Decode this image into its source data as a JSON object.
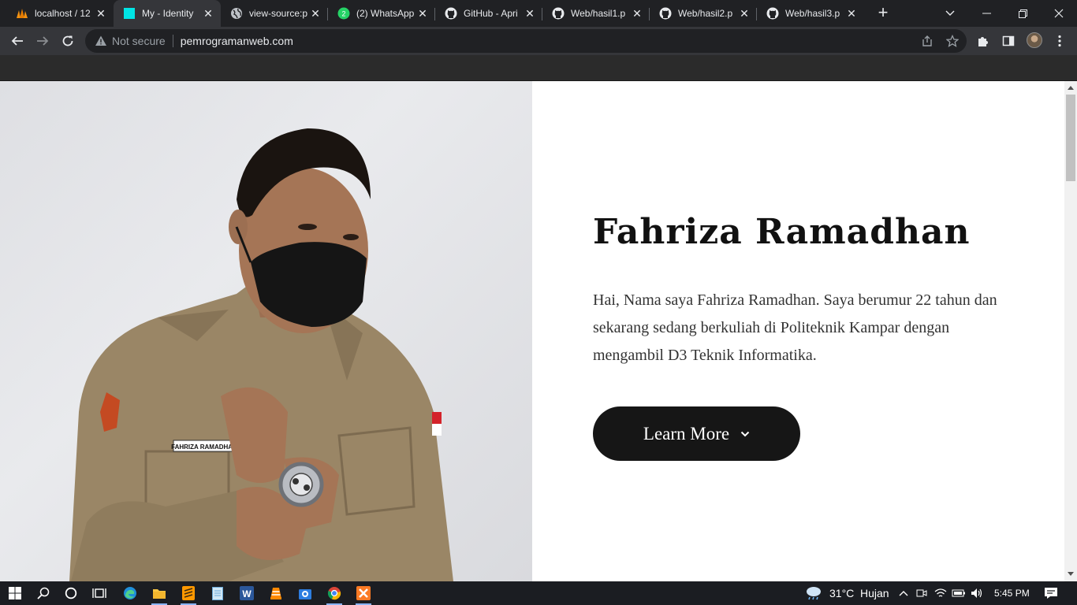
{
  "browser": {
    "tabs": [
      {
        "title": "localhost / 12",
        "icon": "phpmyadmin-icon",
        "active": false
      },
      {
        "title": "My - Identity",
        "icon": "cyan-square-icon",
        "active": true
      },
      {
        "title": "view-source:p",
        "icon": "globe-icon",
        "active": false
      },
      {
        "title": "(2) WhatsApp",
        "icon": "whatsapp-icon",
        "active": false
      },
      {
        "title": "GitHub - Apri",
        "icon": "github-icon",
        "active": false
      },
      {
        "title": "Web/hasil1.p",
        "icon": "github-icon",
        "active": false
      },
      {
        "title": "Web/hasil2.p",
        "icon": "github-icon",
        "active": false
      },
      {
        "title": "Web/hasil3.p",
        "icon": "github-icon",
        "active": false
      }
    ],
    "security_label": "Not secure",
    "url": "pemrogramanweb.com"
  },
  "hero": {
    "name": "Fahriza Ramadhan",
    "description": "Hai, Nama saya Fahriza Ramadhan. Saya berumur 22 tahun dan sekarang sedang berkuliah di Politeknik Kampar dengan mengambil D3 Teknik Informatika.",
    "button_label": "Learn More",
    "nametag": "FAHRIZA RAMADHAN"
  },
  "taskbar": {
    "weather_temp": "31°C",
    "weather_text": "Hujan",
    "time": "5:45 PM"
  },
  "colors": {
    "tab_strip": "#202124",
    "toolbar": "#35363a",
    "accent_button": "#161616",
    "active_tab_favicon": "#00e5e5"
  }
}
